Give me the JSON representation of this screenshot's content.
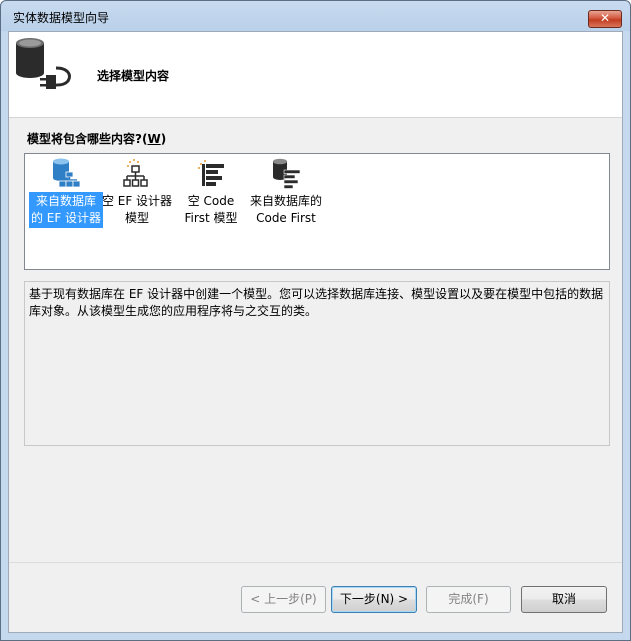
{
  "window": {
    "title": "实体数据模型向导",
    "close_glyph": "✕"
  },
  "banner": {
    "title": "选择模型内容"
  },
  "prompt": {
    "text": "模型将包含哪些内容?(",
    "hotkey": "W",
    "suffix": ")"
  },
  "items": [
    {
      "label_line1": "来自数据库",
      "label_line2": "的 EF 设计器",
      "icon": "database-designer-icon",
      "selected": true
    },
    {
      "label_line1": "空 EF 设计器",
      "label_line2": "模型",
      "icon": "empty-model-icon",
      "selected": false
    },
    {
      "label_line1": "空 Code",
      "label_line2": "First 模型",
      "icon": "empty-code-first-icon",
      "selected": false
    },
    {
      "label_line1": "来自数据库的",
      "label_line2": "Code First",
      "icon": "database-code-first-icon",
      "selected": false
    }
  ],
  "description": "基于现有数据库在 EF 设计器中创建一个模型。您可以选择数据库连接、模型设置以及要在模型中包括的数据库对象。从该模型生成您的应用程序将与之交互的类。",
  "buttons": {
    "back": "< 上一步(P)",
    "next": "下一步(N) >",
    "finish": "完成(F)",
    "cancel": "取消"
  },
  "colors": {
    "selection": "#3399ff",
    "db_blue": "#2f7fc6",
    "db_dark": "#2b2b2b"
  }
}
